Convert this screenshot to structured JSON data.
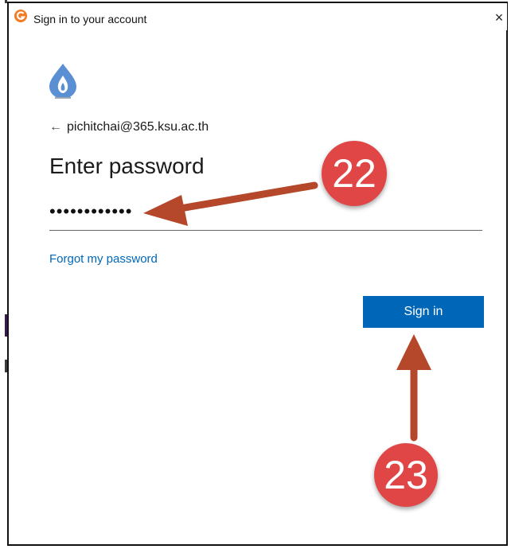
{
  "window": {
    "title": "Sign in to your account",
    "close_glyph": "×"
  },
  "account": {
    "back_arrow": "←",
    "email": "pichitchai@365.ksu.ac.th"
  },
  "form": {
    "heading": "Enter password",
    "password_value": "••••••••••••",
    "forgot_link": "Forgot my password",
    "signin_label": "Sign in"
  },
  "annotations": [
    {
      "label": "22",
      "points_to": "password-field"
    },
    {
      "label": "23",
      "points_to": "sign-in-button"
    }
  ],
  "colors": {
    "accent": "#0067b8",
    "annotation_badge": "#e04646",
    "annotation_arrow": "#b5472a",
    "app_icon": "#f47a20"
  },
  "icons": {
    "app": "app-logo-icon",
    "org_logo": "flame-drop-logo-icon",
    "close": "close-icon",
    "back": "back-arrow-icon"
  }
}
